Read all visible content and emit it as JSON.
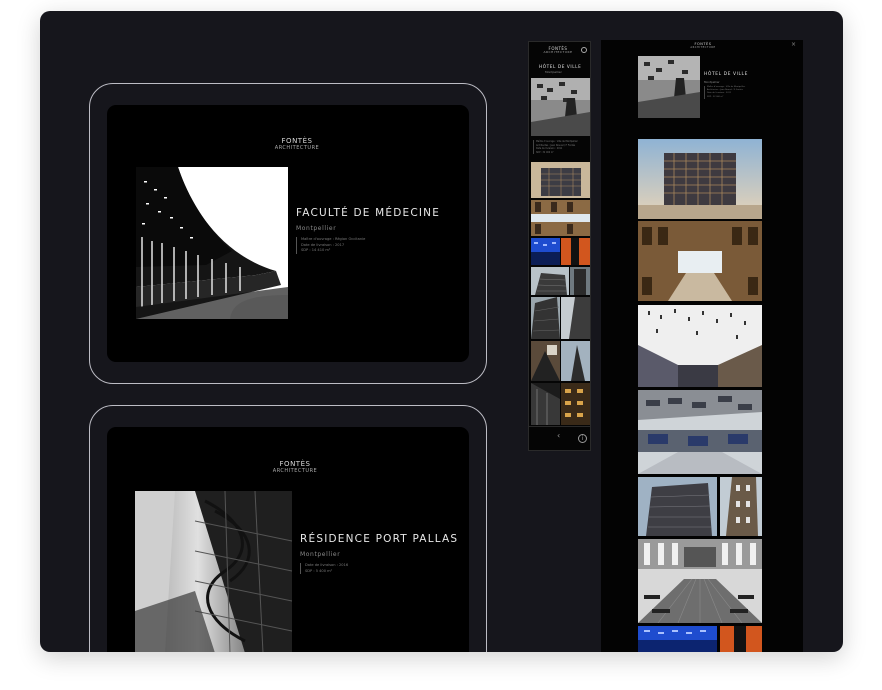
{
  "tablet1": {
    "logo_line1": "FONTÈS",
    "logo_line2": "ARCHITECTURE",
    "title": "FACULTÉ DE MÉDECINE",
    "city": "Montpellier",
    "meta": [
      "Maître d'ouvrage : Région Occitanie",
      "Date de livraison : 2017",
      "SDP : 14 410 m²"
    ]
  },
  "tablet2": {
    "logo_line1": "FONTÈS",
    "logo_line2": "ARCHITECTURE",
    "title": "RÉSIDENCE PORT PALLAS",
    "city": "Montpellier",
    "meta": [
      "Date de livraison : 2016",
      "SDP : 5 400 m²"
    ]
  },
  "phone": {
    "logo_line1": "FONTÈS",
    "logo_line2": "ARCHITECTURE",
    "title": "HÔTEL DE VILLE",
    "city": "Montpellier",
    "meta": [
      "Maître d'ouvrage : Ville de Montpellier",
      "Architectes : Jean Nouvel / F. Fontès",
      "Date de livraison : 2011",
      "SDP : 32 000 m²"
    ],
    "prev_icon": "chevron-left-icon",
    "info_icon": "info-icon"
  },
  "tall": {
    "logo_line1": "FONTÈS",
    "logo_line2": "ARCHITECTURE",
    "title": "HÔTEL DE VILLE",
    "city": "Montpellier",
    "meta": [
      "Maître d'ouvrage : Ville de Montpellier",
      "Architectes : Jean Nouvel / F. Fontès",
      "Date de livraison : 2011",
      "SDP : 32 000 m²"
    ],
    "close_icon": "close-icon"
  },
  "colors": {
    "panel": "#16161c",
    "screen": "#000000",
    "device_border": "#bcbcc4",
    "accent_orange": "#d2561e",
    "accent_blue": "#1e4ccf"
  }
}
